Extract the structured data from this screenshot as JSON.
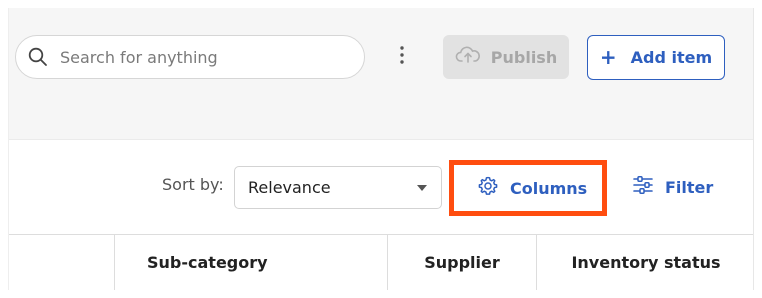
{
  "search": {
    "placeholder": "Search for anything",
    "value": ""
  },
  "topbar": {
    "more_icon": "vertical-ellipsis-icon",
    "publish_label": "Publish",
    "publish_icon": "cloud-upload-icon",
    "add_label": "Add item",
    "add_icon": "plus-icon"
  },
  "toolbar": {
    "sort_label": "Sort by:",
    "sort_value": "Relevance",
    "columns_label": "Columns",
    "columns_icon": "gear-icon",
    "filter_label": "Filter",
    "filter_icon": "sliders-icon",
    "highlight_color": "#ff4d0f"
  },
  "table": {
    "columns": [
      "",
      "Sub-category",
      "Supplier",
      "Inventory status"
    ]
  },
  "colors": {
    "accent": "#2e5fbf",
    "disabled_bg": "#e2e2e2",
    "disabled_text": "#a7a7a7",
    "topbar_bg": "#f6f6f6"
  }
}
